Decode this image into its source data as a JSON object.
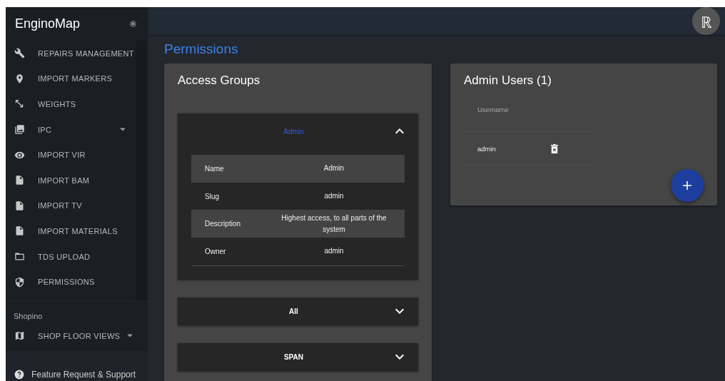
{
  "sidebar": {
    "brand": "EnginoMap",
    "items": [
      {
        "label": "REPAIRS MANAGEMENT",
        "kind": "link"
      },
      {
        "label": "IMPORT MARKERS",
        "kind": "link"
      },
      {
        "label": "WEIGHTS",
        "kind": "link"
      },
      {
        "label": "IPC",
        "kind": "group"
      },
      {
        "label": "IMPORT VIR",
        "kind": "link"
      },
      {
        "label": "IMPORT BAM",
        "kind": "link"
      },
      {
        "label": "IMPORT TV",
        "kind": "link"
      },
      {
        "label": "IMPORT MATERIALS",
        "kind": "link"
      },
      {
        "label": "TDS UPLOAD",
        "kind": "link"
      },
      {
        "label": "PERMISSIONS",
        "kind": "link"
      }
    ],
    "sections": [
      {
        "title": "Shopino",
        "items": [
          {
            "label": "SHOP FLOOR VIEWS",
            "kind": "group"
          }
        ]
      }
    ],
    "footer": "Feature Request & Support"
  },
  "topbar": {
    "avatar": "ℝ"
  },
  "page_title": "Permissions",
  "access_groups": {
    "title": "Access Groups",
    "groups": [
      {
        "name": "Admin",
        "expanded": true,
        "details": [
          {
            "label": "Name",
            "value": "Admin"
          },
          {
            "label": "Slug",
            "value": "admin"
          },
          {
            "label": "Description",
            "value": "Highest access, to all parts of the system"
          },
          {
            "label": "Owner",
            "value": "admin"
          }
        ]
      },
      {
        "name": "All",
        "expanded": false
      },
      {
        "name": "SPAN",
        "expanded": false
      }
    ]
  },
  "admin_users": {
    "title": "Admin Users (1)",
    "columns": [
      "Username"
    ],
    "rows": [
      {
        "username": "admin"
      }
    ]
  }
}
